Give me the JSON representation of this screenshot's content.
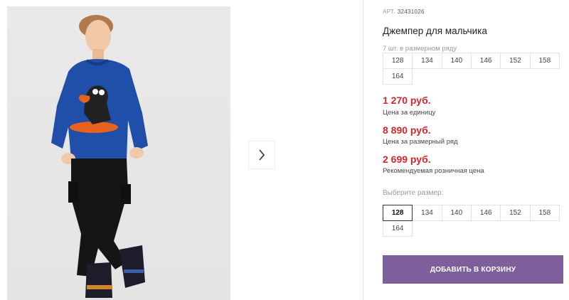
{
  "product": {
    "sku_label": "АРТ.",
    "sku_number": "32431026",
    "title": "Джемпер для мальчика",
    "pack_note": "7 шт. в размерном ряду",
    "pack_sizes": [
      "128",
      "134",
      "140",
      "146",
      "152",
      "158",
      "164"
    ],
    "prices": [
      {
        "value": "1 270 руб.",
        "label": "Цена за единицу"
      },
      {
        "value": "8 890 руб.",
        "label": "Цена за размерный ряд"
      },
      {
        "value": "2 699 руб.",
        "label": "Рекомендуемая розничная цена"
      }
    ],
    "choose_size_label": "Выберите размер:",
    "size_options": [
      "128",
      "134",
      "140",
      "146",
      "152",
      "158",
      "164"
    ],
    "selected_size": "128",
    "add_to_cart_label": "ДОБАВИТЬ В КОРЗИНУ"
  },
  "gallery": {
    "next_icon": "chevron-right-icon"
  },
  "colors": {
    "price": "#d0282e",
    "cart_button": "#7d5f9b",
    "sweater": "#1f4fa8"
  }
}
